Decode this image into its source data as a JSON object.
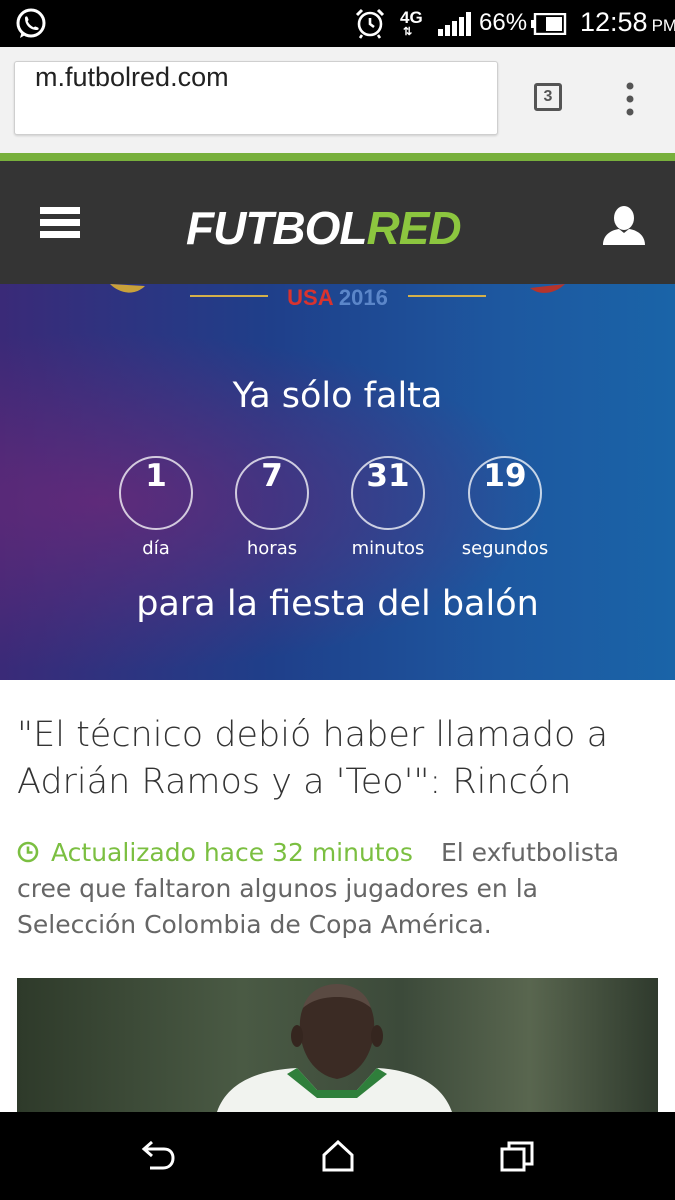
{
  "status_bar": {
    "network": "4G",
    "battery": "66%",
    "time": "12:58",
    "ampm": "PM",
    "icons": [
      "whatsapp-icon",
      "alarm-icon",
      "signal-icon",
      "battery-icon"
    ]
  },
  "browser": {
    "url": "m.futbolred.com",
    "tab_count": "3"
  },
  "site": {
    "logo_part1": "FUTBOL",
    "logo_part2": "RED"
  },
  "banner": {
    "edition_country": "USA",
    "edition_year": "2016",
    "heading": "Ya sólo falta",
    "countdown": [
      {
        "value": "1",
        "label": "día"
      },
      {
        "value": "7",
        "label": "horas"
      },
      {
        "value": "31",
        "label": "minutos"
      },
      {
        "value": "19",
        "label": "segundos"
      }
    ],
    "subheading": "para la fiesta del balón"
  },
  "article": {
    "title": "\"El técnico debió haber llamado a Adrián Ramos y a 'Teo'\": Rincón",
    "updated": "Actualizado hace 32 minutos",
    "summary": "El exfutbolista cree que faltaron algunos jugadores en la Selección Colombia de Copa América."
  },
  "colors": {
    "accent": "#8cc63f",
    "header_bg": "#343434",
    "updated_green": "#7bbf41"
  }
}
